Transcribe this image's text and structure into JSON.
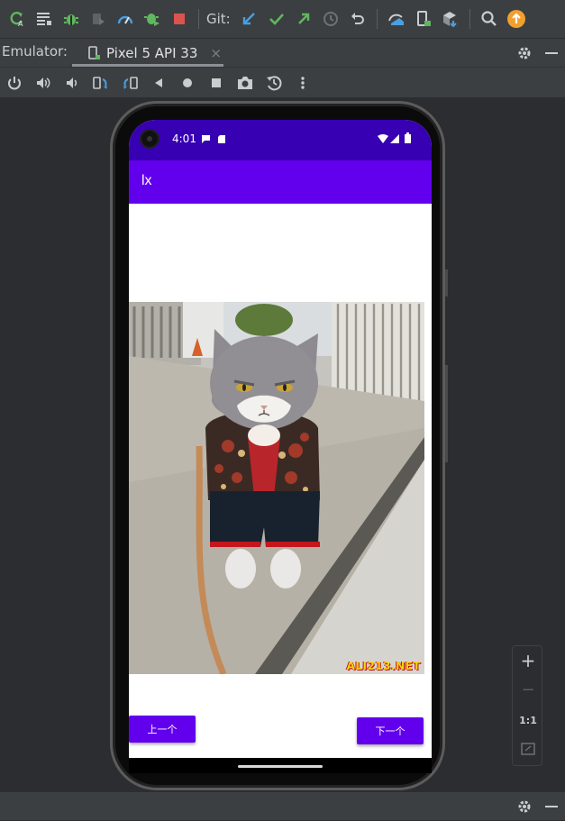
{
  "toolbar": {
    "git_label": "Git:",
    "icons": [
      "apply-changes-icon",
      "logcat-icon",
      "debug-icon",
      "attach-debugger-icon",
      "profiler-icon",
      "debug-attach-icon",
      "stop-icon",
      "git-update-icon",
      "git-commit-icon",
      "git-push-icon",
      "git-history-icon",
      "git-rollback-icon",
      "sync-icon",
      "device-manager-icon",
      "sdk-manager-icon",
      "search-icon",
      "update-icon"
    ]
  },
  "emulator_tab": {
    "label": "Emulator:",
    "device": "Pixel 5 API 33",
    "close": "×"
  },
  "device": {
    "status_time": "4:01",
    "app_title": "lx",
    "watermark": "ALI213.NET",
    "prev_button": "上一个",
    "next_button": "下一个"
  },
  "zoom": {
    "plus": "+",
    "minus": "−",
    "one_to_one": "1:1"
  },
  "colors": {
    "status_bar": "#3700b3",
    "app_bar": "#6200ee",
    "button": "#6200ee",
    "ide_bg": "#2b2d30",
    "ide_toolbar": "#3c3f41"
  }
}
